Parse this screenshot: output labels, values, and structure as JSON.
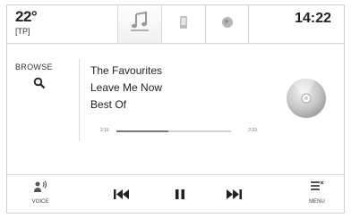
{
  "status": {
    "temperature": "22°",
    "tp": "[TP]",
    "time": "14:22"
  },
  "tabs": [
    {
      "icon": "music-note-icon",
      "active": true
    },
    {
      "icon": "phone-icon",
      "active": false
    },
    {
      "icon": "globe-icon",
      "active": false
    }
  ],
  "browse": {
    "label": "BROWSE",
    "icon": "search-icon"
  },
  "track": {
    "title": "The Favourites",
    "artist": "Leave Me Now",
    "album": "Best Of"
  },
  "progress": {
    "elapsed": "2:16",
    "total": "2:33",
    "fraction": 0.45
  },
  "footer": {
    "voice_label": "VOICE",
    "menu_label": "MENU",
    "controls": [
      "previous-icon",
      "pause-icon",
      "next-icon"
    ]
  },
  "colors": {
    "accent": "#888888",
    "divider": "#d6d6d6"
  }
}
